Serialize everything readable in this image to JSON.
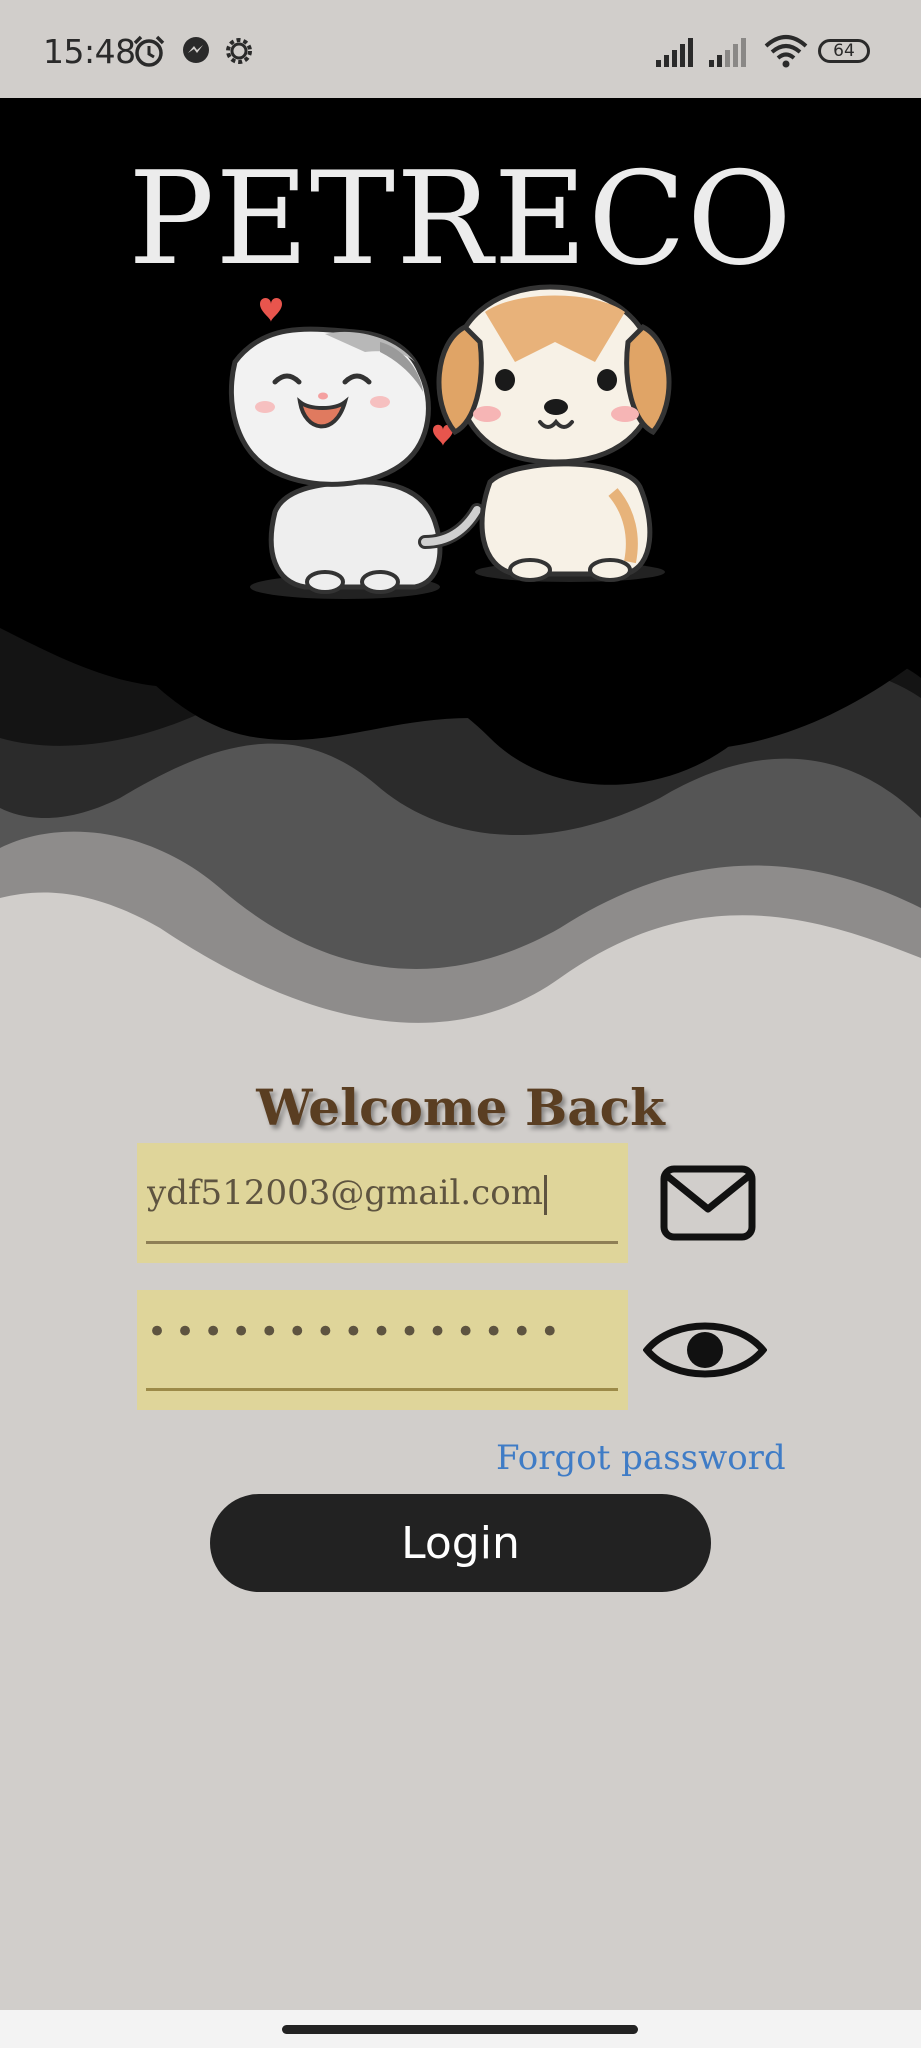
{
  "status_bar": {
    "time": "15:48",
    "battery": "64",
    "left_icons": [
      "alarm-icon",
      "messenger-icon",
      "settings-gear-icon"
    ],
    "right_icons": [
      "signal-icon",
      "signal-icon-2",
      "wifi-icon",
      "battery-icon"
    ]
  },
  "app": {
    "title": "PETRECO"
  },
  "login": {
    "heading": "Welcome Back",
    "email_value": "ydf512003@gmail.com",
    "password_mask": "•••••••••••••••",
    "email_icon": "mail-icon",
    "password_icon": "eye-icon",
    "forgot_label": "Forgot password",
    "login_label": "Login"
  },
  "colors": {
    "background": "#d1cecb",
    "hero": "#000000",
    "field_fill": "#dfd59a",
    "heading": "#5a3e22",
    "link": "#3f7cc6",
    "button": "#222222"
  }
}
